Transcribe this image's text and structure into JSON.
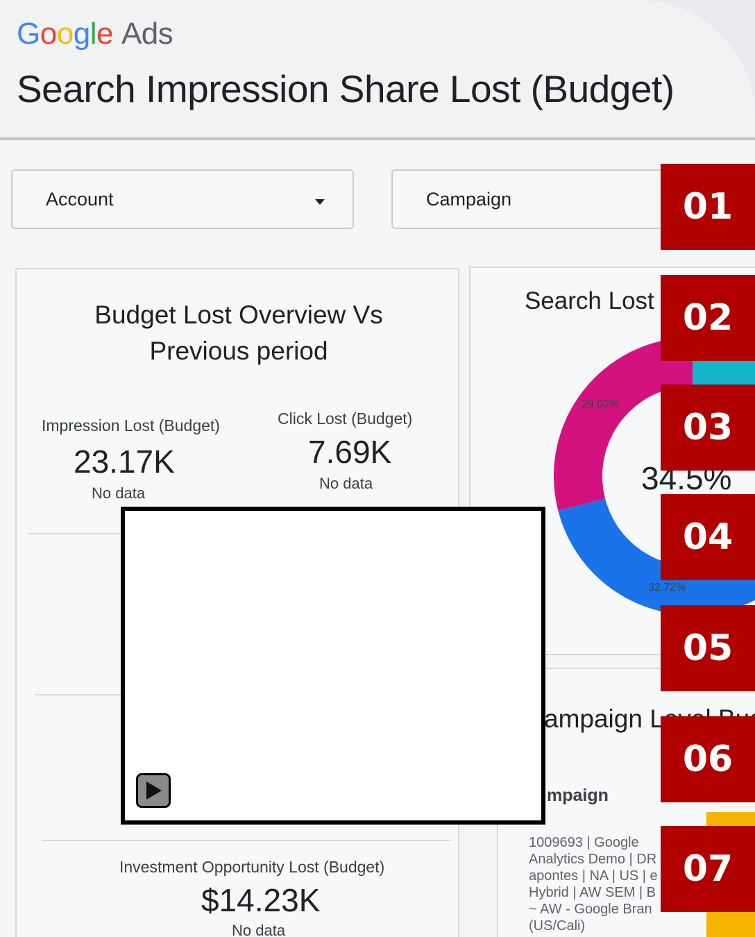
{
  "header": {
    "brand": {
      "g": "G",
      "o1": "o",
      "o2": "o",
      "g2": "g",
      "l": "l",
      "e": "e",
      "ads": "Ads"
    },
    "title": "Search Impression Share Lost (Budget)"
  },
  "filters": {
    "account": "Account",
    "campaign": "Campaign"
  },
  "overview": {
    "title_line1": "Budget Lost Overview Vs",
    "title_line2": "Previous period",
    "impression": {
      "label": "Impression Lost (Budget)",
      "value": "23.17K",
      "sub": "No data"
    },
    "click": {
      "label": "Click Lost (Budget)",
      "value": "7.69K",
      "sub": "No data"
    },
    "investment": {
      "label": "Investment Opportunity Lost (Budget)",
      "value": "$14.23K",
      "sub": "No data"
    }
  },
  "donut_card": {
    "title": "Search Lost I",
    "center": "34.5%",
    "slices": [
      {
        "label": "29.02%",
        "value": 29.02,
        "color": "#d4127f"
      },
      {
        "label": "32.72%",
        "value": 32.72,
        "color": "#1a73e8"
      },
      {
        "label": "",
        "value": 38.26,
        "color": "#12b5cb"
      }
    ]
  },
  "campaign_card": {
    "title": "ampaign Level Budg",
    "column": "mpaign",
    "row_lines": [
      "1009693 | Google",
      "Analytics Demo | DR",
      "apontes | NA | US | e",
      "Hybrid | AW SEM | B",
      "~ AW - Google Bran",
      "(US/Cali)"
    ]
  },
  "steps": [
    "01",
    "02",
    "03",
    "04",
    "05",
    "06",
    "07"
  ],
  "colors": {
    "step_bg": "#b00000",
    "pink": "#d4127f",
    "blue": "#1a73e8",
    "teal": "#12b5cb",
    "gold": "#f4b400"
  }
}
